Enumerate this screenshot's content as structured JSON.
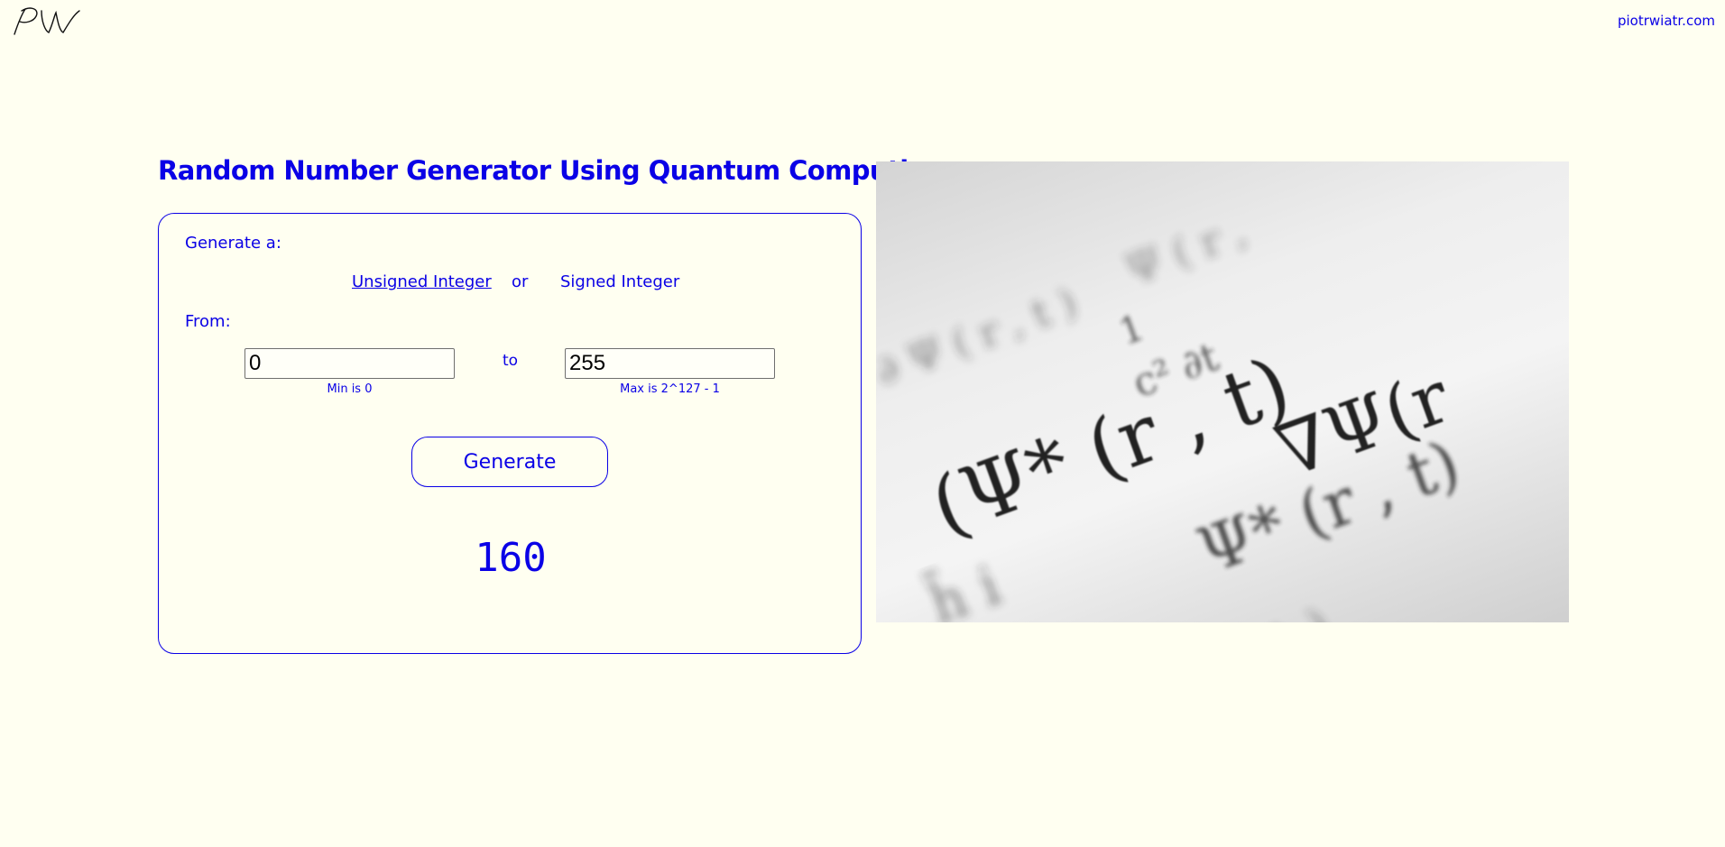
{
  "header": {
    "logo_icon": "pw-signature-logo",
    "site_link": "piotrwiatr.com"
  },
  "main": {
    "title": "Random Number Generator Using Quantum Computing",
    "generate_label": "Generate a:",
    "type_options": {
      "unsigned": "Unsigned Integer",
      "or": "or",
      "signed": "Signed Integer"
    },
    "from_label": "From:",
    "to_label": "to",
    "from_value": "0",
    "to_value": "255",
    "min_hint": "Min is 0",
    "max_hint": "Max is 2^127 - 1",
    "generate_button": "Generate",
    "result": "160"
  },
  "colors": {
    "accent": "#0a00e6",
    "background": "#fffff1"
  }
}
